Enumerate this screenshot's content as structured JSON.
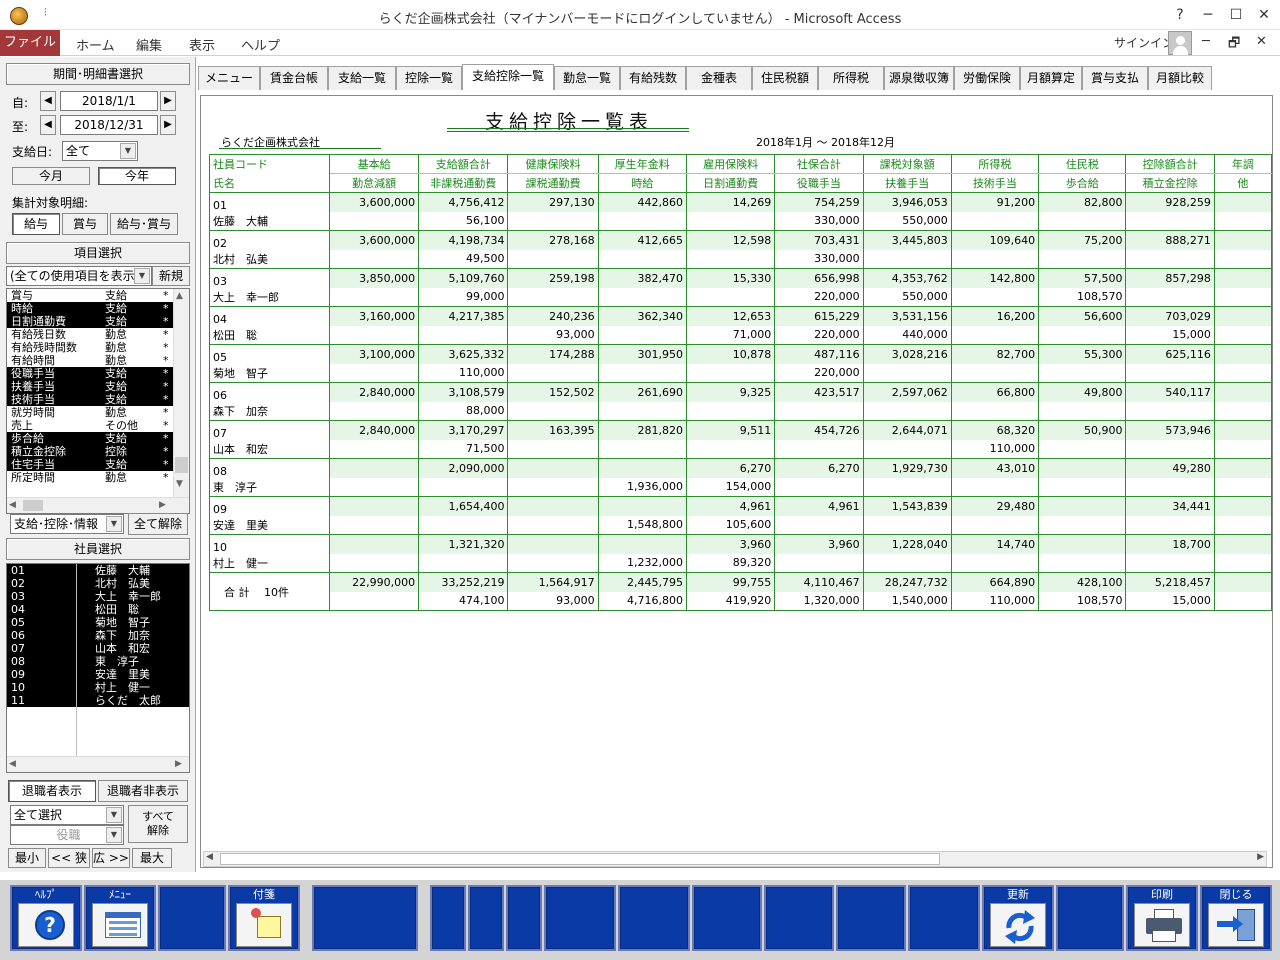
{
  "window": {
    "title": "らくだ企画株式会社（マイナンバーモードにログインしていません） - Microsoft Access",
    "quick_access": "⫶"
  },
  "ribbon": {
    "file": "ファイル",
    "tabs": [
      "ホーム",
      "編集",
      "表示",
      "ヘルプ"
    ],
    "signin": "サインイン"
  },
  "left": {
    "period_header": "期間･明細書選択",
    "from_label": "自:",
    "from_date": "2018/1/1",
    "to_label": "至:",
    "to_date": "2018/12/31",
    "payday_label": "支給日:",
    "payday_value": "全て",
    "this_month": "今月",
    "this_year": "今年",
    "target_label": "集計対象明細:",
    "target_buttons": [
      "給与",
      "賞与",
      "給与･賞与"
    ],
    "item_header": "項目選択",
    "item_filter": "(全ての使用項目を表示)",
    "new_button": "新規",
    "items": [
      {
        "name": "賞与",
        "type": "支給",
        "mark": "*",
        "sel": false
      },
      {
        "name": "時給",
        "type": "支給",
        "mark": "*",
        "sel": true
      },
      {
        "name": "日割通勤費",
        "type": "支給",
        "mark": "*",
        "sel": true
      },
      {
        "name": "有給残日数",
        "type": "勤怠",
        "mark": "*",
        "sel": false
      },
      {
        "name": "有給残時間数",
        "type": "勤怠",
        "mark": "*",
        "sel": false
      },
      {
        "name": "有給時間",
        "type": "勤怠",
        "mark": "*",
        "sel": false
      },
      {
        "name": "役職手当",
        "type": "支給",
        "mark": "*",
        "sel": true
      },
      {
        "name": "扶養手当",
        "type": "支給",
        "mark": "*",
        "sel": true
      },
      {
        "name": "技術手当",
        "type": "支給",
        "mark": "*",
        "sel": true
      },
      {
        "name": "就労時間",
        "type": "勤怠",
        "mark": "*",
        "sel": false
      },
      {
        "name": "売上",
        "type": "その他",
        "mark": "*",
        "sel": false
      },
      {
        "name": "歩合給",
        "type": "支給",
        "mark": "*",
        "sel": true
      },
      {
        "name": "積立金控除",
        "type": "控除",
        "mark": "*",
        "sel": true
      },
      {
        "name": "住宅手当",
        "type": "支給",
        "mark": "*",
        "sel": true
      },
      {
        "name": "所定時間",
        "type": "勤怠",
        "mark": "*",
        "sel": false
      }
    ],
    "item_kind_filter": "支給･控除･情報",
    "clear_all": "全て解除",
    "emp_header": "社員選択",
    "employees": [
      {
        "code": "01",
        "name": "佐藤　大輔"
      },
      {
        "code": "02",
        "name": "北村　弘美"
      },
      {
        "code": "03",
        "name": "大上　幸一郎"
      },
      {
        "code": "04",
        "name": "松田　聡"
      },
      {
        "code": "05",
        "name": "菊地　智子"
      },
      {
        "code": "06",
        "name": "森下　加奈"
      },
      {
        "code": "07",
        "name": "山本　和宏"
      },
      {
        "code": "08",
        "name": "東　淳子"
      },
      {
        "code": "09",
        "name": "安達　里美"
      },
      {
        "code": "10",
        "name": "村上　健一"
      },
      {
        "code": "11",
        "name": "らくだ　太郎"
      }
    ],
    "show_retired": "退職者表示",
    "hide_retired": "退職者非表示",
    "select_all": "全て選択",
    "position": "役職",
    "release_all": "すべて解除",
    "zoom_buttons": [
      "最小",
      "<< 狭",
      "広 >>",
      "最大"
    ]
  },
  "tabs": [
    "メニュー",
    "賃金台帳",
    "支給一覧",
    "控除一覧",
    "支給控除一覧",
    "勤怠一覧",
    "有給残数",
    "金種表",
    "住民税額",
    "所得税",
    "源泉徴収簿",
    "労働保険",
    "月額算定",
    "賞与支払",
    "月額比較"
  ],
  "active_tab": 4,
  "report": {
    "title": "支給控除一覧表",
    "company": "らくだ企画株式会社",
    "period": "2018年1月 ～ 2018年12月",
    "header1": [
      "社員コード",
      "基本給",
      "支給額合計",
      "健康保険料",
      "厚生年金料",
      "雇用保険料",
      "社保合計",
      "課税対象額",
      "所得税",
      "住民税",
      "控除額合計",
      "年調"
    ],
    "header2": [
      "氏名",
      "勤怠減額",
      "非課税通勤費",
      "課税通勤費",
      "時給",
      "日割通勤費",
      "役職手当",
      "扶養手当",
      "技術手当",
      "歩合給",
      "積立金控除",
      "他"
    ],
    "rows": [
      {
        "code": "01",
        "name": "佐藤　大輔",
        "r1": [
          "3,600,000",
          "4,756,412",
          "297,130",
          "442,860",
          "14,269",
          "754,259",
          "3,946,053",
          "91,200",
          "82,800",
          "928,259",
          ""
        ],
        "r2": [
          "",
          "56,100",
          "",
          "",
          "",
          "330,000",
          "550,000",
          "",
          "",
          "",
          ""
        ]
      },
      {
        "code": "02",
        "name": "北村　弘美",
        "r1": [
          "3,600,000",
          "4,198,734",
          "278,168",
          "412,665",
          "12,598",
          "703,431",
          "3,445,803",
          "109,640",
          "75,200",
          "888,271",
          ""
        ],
        "r2": [
          "",
          "49,500",
          "",
          "",
          "",
          "330,000",
          "",
          "",
          "",
          "",
          ""
        ]
      },
      {
        "code": "03",
        "name": "大上　幸一郎",
        "r1": [
          "3,850,000",
          "5,109,760",
          "259,198",
          "382,470",
          "15,330",
          "656,998",
          "4,353,762",
          "142,800",
          "57,500",
          "857,298",
          ""
        ],
        "r2": [
          "",
          "99,000",
          "",
          "",
          "",
          "220,000",
          "550,000",
          "",
          "108,570",
          "",
          ""
        ]
      },
      {
        "code": "04",
        "name": "松田　聡",
        "r1": [
          "3,160,000",
          "4,217,385",
          "240,236",
          "362,340",
          "12,653",
          "615,229",
          "3,531,156",
          "16,200",
          "56,600",
          "703,029",
          ""
        ],
        "r2": [
          "",
          "",
          "93,000",
          "",
          "71,000",
          "220,000",
          "440,000",
          "",
          "",
          "15,000",
          ""
        ]
      },
      {
        "code": "05",
        "name": "菊地　智子",
        "r1": [
          "3,100,000",
          "3,625,332",
          "174,288",
          "301,950",
          "10,878",
          "487,116",
          "3,028,216",
          "82,700",
          "55,300",
          "625,116",
          ""
        ],
        "r2": [
          "",
          "110,000",
          "",
          "",
          "",
          "220,000",
          "",
          "",
          "",
          "",
          ""
        ]
      },
      {
        "code": "06",
        "name": "森下　加奈",
        "r1": [
          "2,840,000",
          "3,108,579",
          "152,502",
          "261,690",
          "9,325",
          "423,517",
          "2,597,062",
          "66,800",
          "49,800",
          "540,117",
          ""
        ],
        "r2": [
          "",
          "88,000",
          "",
          "",
          "",
          "",
          "",
          "",
          "",
          "",
          ""
        ]
      },
      {
        "code": "07",
        "name": "山本　和宏",
        "r1": [
          "2,840,000",
          "3,170,297",
          "163,395",
          "281,820",
          "9,511",
          "454,726",
          "2,644,071",
          "68,320",
          "50,900",
          "573,946",
          ""
        ],
        "r2": [
          "",
          "71,500",
          "",
          "",
          "",
          "",
          "",
          "110,000",
          "",
          "",
          ""
        ]
      },
      {
        "code": "08",
        "name": "東　淳子",
        "r1": [
          "",
          "2,090,000",
          "",
          "",
          "6,270",
          "6,270",
          "1,929,730",
          "43,010",
          "",
          "49,280",
          ""
        ],
        "r2": [
          "",
          "",
          "",
          "1,936,000",
          "154,000",
          "",
          "",
          "",
          "",
          "",
          ""
        ]
      },
      {
        "code": "09",
        "name": "安達　里美",
        "r1": [
          "",
          "1,654,400",
          "",
          "",
          "4,961",
          "4,961",
          "1,543,839",
          "29,480",
          "",
          "34,441",
          ""
        ],
        "r2": [
          "",
          "",
          "",
          "1,548,800",
          "105,600",
          "",
          "",
          "",
          "",
          "",
          ""
        ]
      },
      {
        "code": "10",
        "name": "村上　健一",
        "r1": [
          "",
          "1,321,320",
          "",
          "",
          "3,960",
          "3,960",
          "1,228,040",
          "14,740",
          "",
          "18,700",
          ""
        ],
        "r2": [
          "",
          "",
          "",
          "1,232,000",
          "89,320",
          "",
          "",
          "",
          "",
          "",
          ""
        ]
      }
    ],
    "total_label": "合 計　 10件",
    "total_r1": [
      "22,990,000",
      "33,252,219",
      "1,564,917",
      "2,445,795",
      "99,755",
      "4,110,467",
      "28,247,732",
      "664,890",
      "428,100",
      "5,218,457",
      ""
    ],
    "total_r2": [
      "",
      "474,100",
      "93,000",
      "4,716,800",
      "419,920",
      "1,320,000",
      "1,540,000",
      "110,000",
      "108,570",
      "15,000",
      ""
    ]
  },
  "fkeys": {
    "help": "ﾍﾙﾌﾟ",
    "menu": "ﾒﾆｭｰ",
    "sticky": "付箋",
    "refresh": "更新",
    "print": "印刷",
    "close": "閉じる"
  },
  "colors": {
    "file_tab": "#a4373a",
    "fkey_blue": "#0a3aa5",
    "grid_green": "#2e8b2e",
    "row_tint": "#e6f6e6"
  }
}
